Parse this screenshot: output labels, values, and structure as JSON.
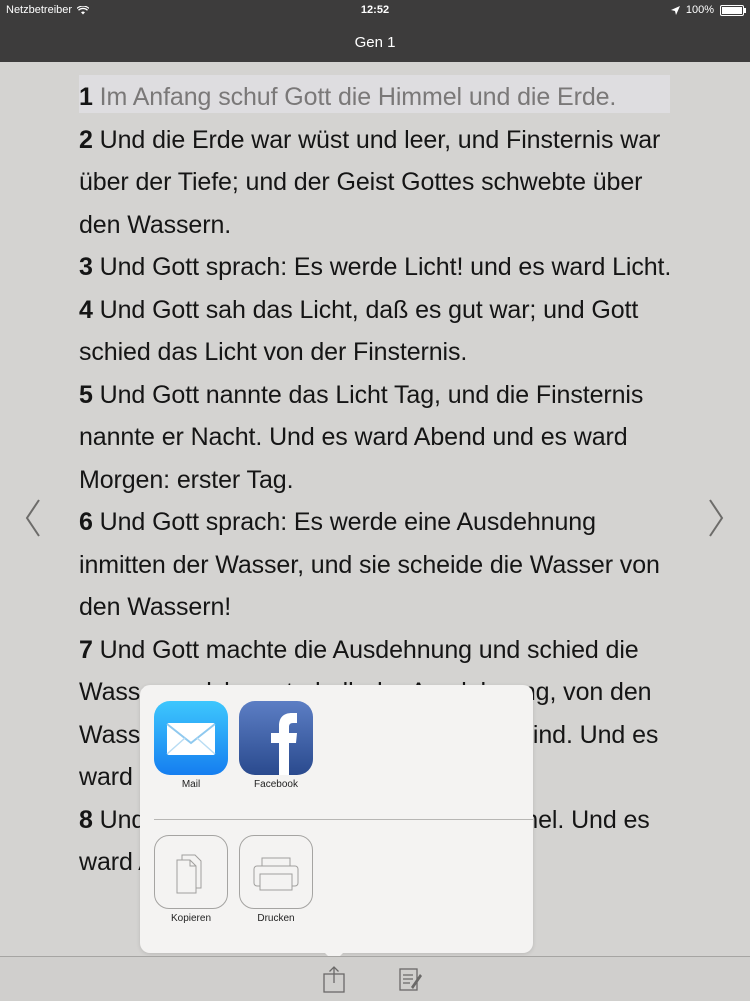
{
  "status": {
    "carrier": "Netzbetreiber",
    "time": "12:52",
    "battery": "100%"
  },
  "nav": {
    "title": "Gen 1"
  },
  "verses": [
    {
      "num": "1",
      "text": "Im Anfang schuf Gott die Himmel und die Erde."
    },
    {
      "num": "2",
      "text": "Und die Erde war wüst und leer, und Finsternis war über der Tiefe; und der Geist Gottes schwebte über den Wassern."
    },
    {
      "num": "3",
      "text": "Und Gott sprach: Es werde Licht! und es ward Licht."
    },
    {
      "num": "4",
      "text": "Und Gott sah das Licht, daß es gut war; und Gott schied das Licht von der Finsternis."
    },
    {
      "num": "5",
      "text": "Und Gott nannte das Licht Tag, und die Finsternis nannte er Nacht. Und es ward Abend und es ward Morgen: erster Tag."
    },
    {
      "num": "6",
      "text": "Und Gott sprach: Es werde eine Ausdehnung inmitten der Wasser, und sie scheide die Wasser von den Wassern!"
    },
    {
      "num": "7",
      "text": "Und Gott machte die Ausdehnung und schied die Wasser, welche unterhalb der Ausdehnung, von den Wassern, die oberhalb der Ausdehnung sind. Und es ward also."
    },
    {
      "num": "8",
      "text": "Und Gott nannte die Ausdehnung Himmel. Und es ward Abend und es ward Morgen:"
    }
  ],
  "share_sheet": {
    "apps": [
      {
        "label": "Mail",
        "icon": "mail-icon"
      },
      {
        "label": "Facebook",
        "icon": "facebook-icon"
      }
    ],
    "actions": [
      {
        "label": "Kopieren",
        "icon": "copy-icon"
      },
      {
        "label": "Drucken",
        "icon": "print-icon"
      }
    ]
  },
  "icons": {
    "back": "chevron-left-icon",
    "forward": "chevron-right-icon",
    "share": "share-icon",
    "notes": "notes-icon"
  },
  "colors": {
    "bars": "#3d3c3c",
    "page": "#d4d3d1",
    "highlight": "#dedde0",
    "popover": "#f4f3f2"
  }
}
